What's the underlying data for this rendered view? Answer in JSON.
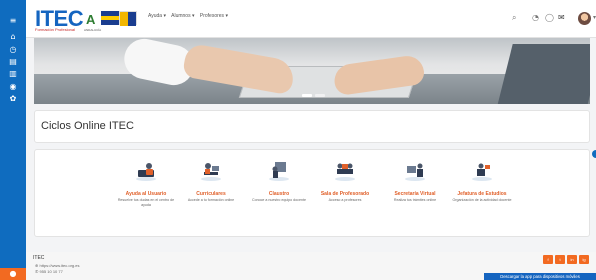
{
  "sidebar": {
    "items": [
      {
        "icon": "menu-icon",
        "glyph": "≡"
      },
      {
        "icon": "home-icon",
        "glyph": "⌂"
      },
      {
        "icon": "dashboard-icon",
        "glyph": "◷"
      },
      {
        "icon": "calendar-icon",
        "glyph": "▤"
      },
      {
        "icon": "folder-icon",
        "glyph": "▥"
      },
      {
        "icon": "course-icon",
        "glyph": "◉"
      },
      {
        "icon": "settings-icon",
        "glyph": "✿"
      }
    ],
    "bottom_icon": "user-icon"
  },
  "header": {
    "logo": "ITEC",
    "logo_sub": "Formación Profesional",
    "logo_a": "A",
    "logo_a_sub": "ANDALUCÍA",
    "nav": [
      "Ayuda ▾",
      "Alumnos ▾",
      "Profesores ▾"
    ],
    "icons": [
      "search-icon",
      "bell-icon",
      "chat-icon",
      "mail-icon",
      "avatar"
    ]
  },
  "banner": {
    "slides": 2,
    "active_slide": 1
  },
  "main": {
    "title": "Ciclos Online ITEC",
    "tiles": [
      {
        "title": "Ayuda al Usuario",
        "desc": "Resuelve tus dudas en el centro de ayuda"
      },
      {
        "title": "Curriculares",
        "desc": "Accede a tu formación online"
      },
      {
        "title": "Claustro",
        "desc": "Conoce a nuestro equipo docente"
      },
      {
        "title": "Sala de Profesorado",
        "desc": "Acceso a profesores"
      },
      {
        "title": "Secretaría Virtual",
        "desc": "Realiza tus trámites online"
      },
      {
        "title": "Jefatura de Estudios",
        "desc": "Organización de la actividad docente"
      }
    ]
  },
  "footer": {
    "title": "ITEC",
    "website": "https://www.itec.org.es",
    "phone": "955 10 10 77",
    "social": [
      "f",
      "t",
      "in",
      "ig"
    ],
    "mobile_app": "Descargar la app para dispositivos móviles"
  },
  "colors": {
    "primary": "#0f6cbf",
    "accent": "#f26a21",
    "tile_title": "#e0602a"
  }
}
